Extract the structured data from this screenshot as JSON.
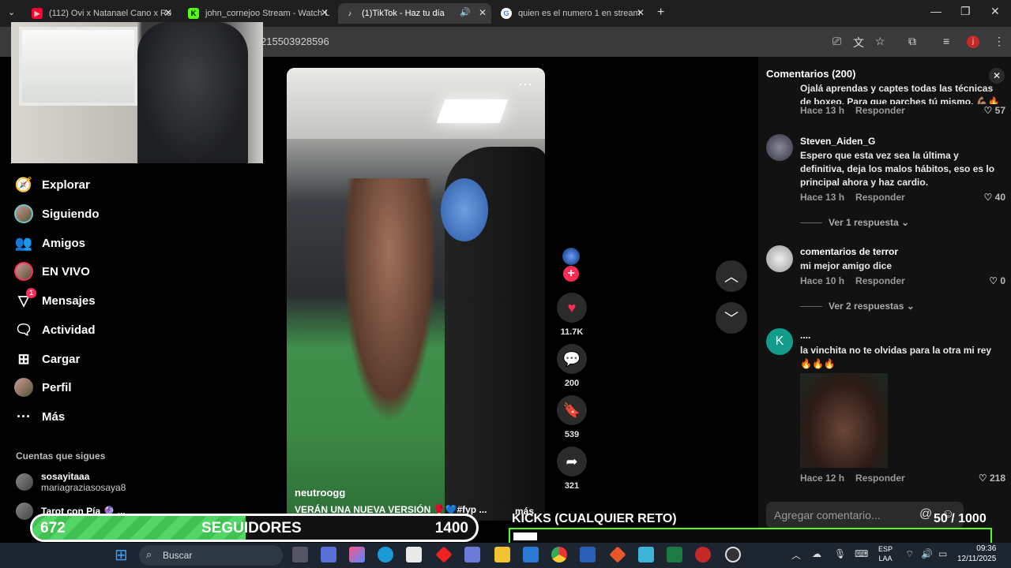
{
  "browser": {
    "tabs": [
      {
        "title": "(112) Ovi x Natanael Cano x Ro",
        "active": false,
        "favicon": "youtube-icon"
      },
      {
        "title": "john_cornejoo Stream - Watch L",
        "active": false,
        "favicon": "kick-icon"
      },
      {
        "title": "(1)TikTok - Haz tu día",
        "active": true,
        "favicon": "tiktok-icon"
      },
      {
        "title": "quien es el numero 1 en stream",
        "active": false,
        "favicon": "google-icon"
      }
    ],
    "url": "215503928596",
    "profile_initial": "j"
  },
  "sidebar": {
    "items": [
      {
        "label": "Explorar",
        "icon": "compass-icon"
      },
      {
        "label": "Siguiendo",
        "icon": "following-avatar"
      },
      {
        "label": "Amigos",
        "icon": "friends-icon"
      },
      {
        "label": "EN VIVO",
        "icon": "live-avatar"
      },
      {
        "label": "Mensajes",
        "icon": "messages-icon",
        "badge": "1"
      },
      {
        "label": "Actividad",
        "icon": "activity-icon"
      },
      {
        "label": "Cargar",
        "icon": "upload-icon"
      },
      {
        "label": "Perfil",
        "icon": "profile-avatar"
      },
      {
        "label": "Más",
        "icon": "more-icon"
      }
    ],
    "following_title": "Cuentas que sigues",
    "accounts": [
      {
        "name": "sosayitaaa",
        "handle": "mariagraziasosaya8"
      },
      {
        "name": "Tarot con Pía 🔮 ..."
      }
    ]
  },
  "video": {
    "username": "neutroogg",
    "description": "VERÁN UNA NUEVA VERSIÓN 🥊💙#fyp ...",
    "more": "más",
    "likes": "11.7K",
    "comments": "200",
    "saves": "539",
    "shares": "321"
  },
  "comments_panel": {
    "title": "Comentarios (200)",
    "input_placeholder": "Agregar comentario...",
    "reply_label": "Responder",
    "items": [
      {
        "text": "Ojalá aprendas y captes todas las técnicas de boxeo. Para que parches tú mismo. 💪🏽🔥",
        "time": "Hace 13 h",
        "likes": "57"
      },
      {
        "user": "Steven_Aiden_G",
        "text": "Espero que esta vez sea la última y definitiva, deja los malos hábitos, eso es lo principal ahora y haz cardio.",
        "time": "Hace 13 h",
        "likes": "40",
        "replies": "Ver 1 respuesta"
      },
      {
        "user": "comentarios de terror",
        "text": "mi mejor amigo dice",
        "time": "Hace 10 h",
        "likes": "0",
        "replies": "Ver 2 respuestas"
      },
      {
        "user": "....",
        "avatar_letter": "K",
        "text": "la vinchita no te olvidas para la otra mi rey 🔥🔥🔥",
        "time": "Hace 12 h",
        "likes": "218"
      }
    ]
  },
  "overlay": {
    "followers_current": "672",
    "followers_label": "SEGUIDORES",
    "followers_goal": "1400",
    "followers_progress": 0.48,
    "kicks_title": "KICKS (CUALQUIER RETO)",
    "kicks_count": "50 / 1000",
    "kicks_progress": 0.05
  },
  "taskbar": {
    "search_placeholder": "Buscar",
    "lang_top": "ESP",
    "lang_bottom": "LAA",
    "time": "09:36",
    "date": "12/11/2025"
  },
  "colors": {
    "accent": "#fe2c55",
    "kick_green": "#53fc18",
    "progress_green": "#3fc251"
  }
}
